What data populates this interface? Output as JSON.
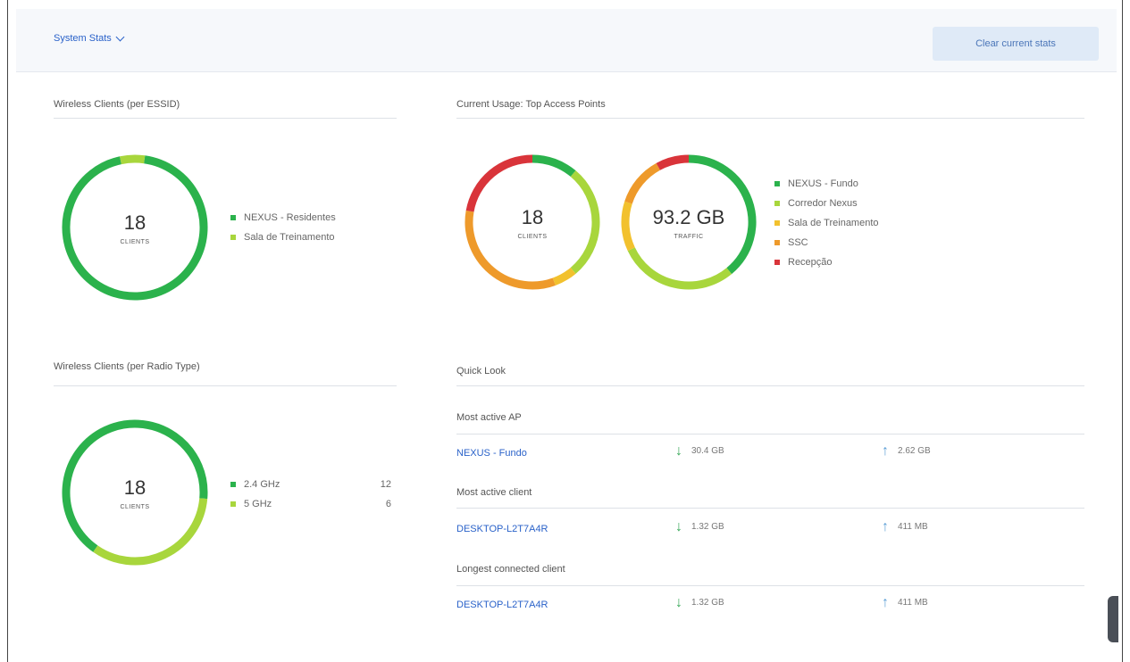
{
  "header": {
    "stats_label": "System Stats",
    "clear_label": "Clear current stats"
  },
  "ssid_panel": {
    "title": "Wireless Clients (per ESSID)",
    "count": "18",
    "unit": "CLIENTS",
    "legend": [
      {
        "label": "NEXUS - Residentes",
        "color": "#2bb24c"
      },
      {
        "label": "Sala de Treinamento",
        "color": "#a8d63c"
      }
    ],
    "slices": [
      {
        "value": 17,
        "color": "#2bb24c"
      },
      {
        "value": 1,
        "color": "#a8d63c"
      }
    ]
  },
  "ap_panel": {
    "title": "Current Usage: Top Access Points",
    "clients_count": "18",
    "clients_unit": "CLIENTS",
    "traffic_value": "93.2 GB",
    "traffic_unit": "TRAFFIC",
    "legend": [
      {
        "label": "NEXUS - Fundo",
        "color": "#2bb24c"
      },
      {
        "label": "Corredor Nexus",
        "color": "#a8d63c"
      },
      {
        "label": "Sala de Treinamento",
        "color": "#f2c12e"
      },
      {
        "label": "SSC",
        "color": "#ee9a2b"
      },
      {
        "label": "Recepção",
        "color": "#d9343a"
      }
    ],
    "clients_slices": [
      {
        "value": 2,
        "color": "#2bb24c"
      },
      {
        "value": 5,
        "color": "#a8d63c"
      },
      {
        "value": 1,
        "color": "#f2c12e"
      },
      {
        "value": 6,
        "color": "#ee9a2b"
      },
      {
        "value": 4,
        "color": "#d9343a"
      }
    ],
    "traffic_slices": [
      {
        "value": 39,
        "color": "#2bb24c"
      },
      {
        "value": 29,
        "color": "#a8d63c"
      },
      {
        "value": 12,
        "color": "#f2c12e"
      },
      {
        "value": 12,
        "color": "#ee9a2b"
      },
      {
        "value": 8,
        "color": "#d9343a"
      }
    ]
  },
  "radio_panel": {
    "title": "Wireless Clients (per Radio Type)",
    "count": "18",
    "unit": "CLIENTS",
    "legend": [
      {
        "label": "2.4 GHz",
        "count": "12",
        "color": "#2bb24c"
      },
      {
        "label": "5 GHz",
        "count": "6",
        "color": "#a8d63c"
      }
    ],
    "slices": [
      {
        "value": 12,
        "color": "#2bb24c"
      },
      {
        "value": 6,
        "color": "#a8d63c"
      }
    ]
  },
  "quick_look": {
    "title": "Quick Look",
    "sections": [
      {
        "label": "Most active AP",
        "name": "NEXUS - Fundo",
        "down": "30.4 GB",
        "up": "2.62 GB"
      },
      {
        "label": "Most active client",
        "name": "DESKTOP-L2T7A4R",
        "down": "1.32 GB",
        "up": "411 MB"
      },
      {
        "label": "Longest connected client",
        "name": "DESKTOP-L2T7A4R",
        "down": "1.32 GB",
        "up": "411 MB"
      }
    ]
  }
}
